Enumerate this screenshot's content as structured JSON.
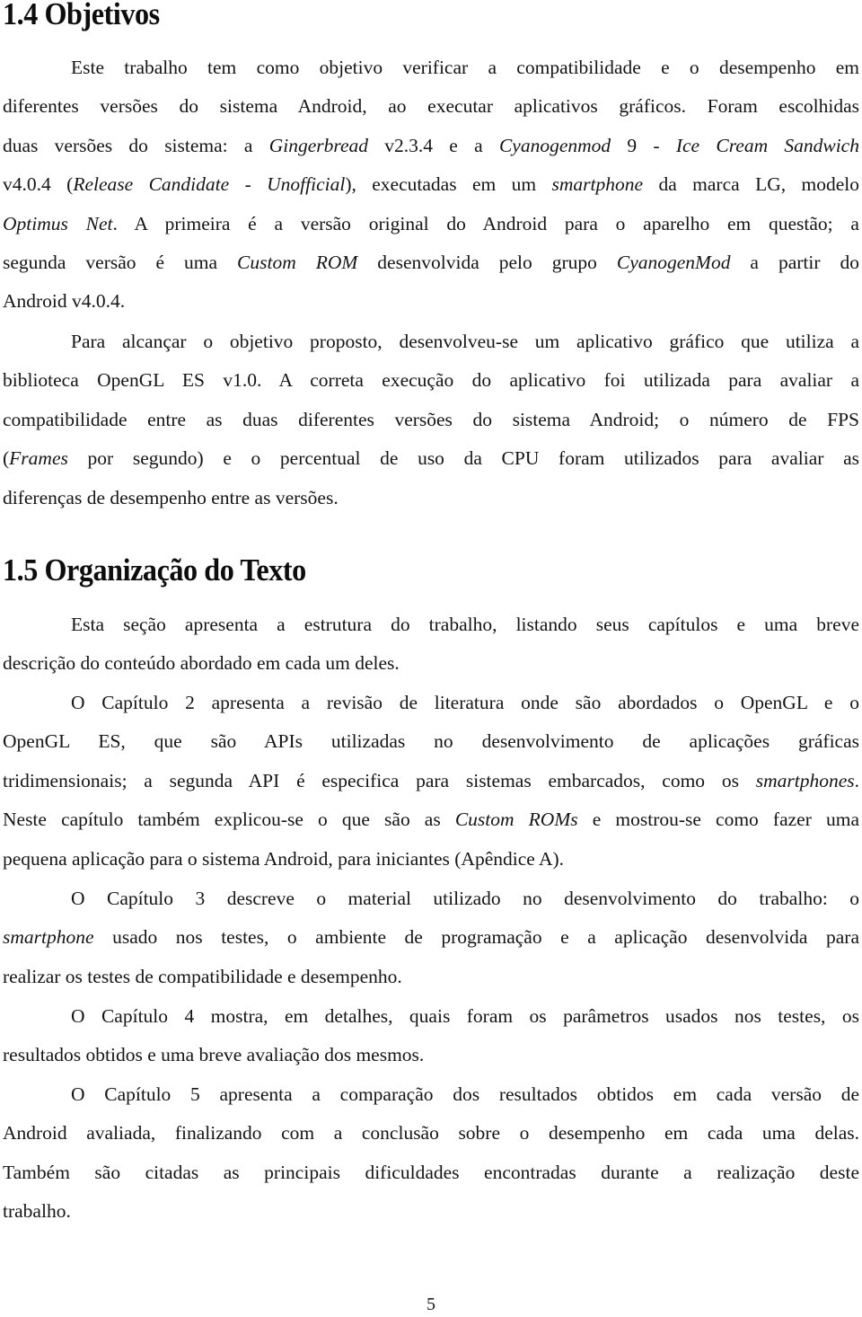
{
  "section_1_4": {
    "title": "1.4 Objetivos",
    "paragraphs": [
      {
        "lines": [
          [
            {
              "t": "Este trabalho tem como objetivo verificar a compatibilidade e o desempenho em"
            }
          ],
          [
            {
              "t": "diferentes versões do sistema Android, ao executar aplicativos gráficos. Foram escolhidas"
            }
          ],
          [
            {
              "t": "duas versões do sistema: a "
            },
            {
              "t": "Gingerbread",
              "i": true
            },
            {
              "t": " v2.3.4 e a "
            },
            {
              "t": "Cyanogenmod",
              "i": true
            },
            {
              "t": " 9 - "
            },
            {
              "t": "Ice Cream Sandwich",
              "i": true
            }
          ],
          [
            {
              "t": "v4.0.4 ("
            },
            {
              "t": "Release Candidate",
              "i": true
            },
            {
              "t": " - "
            },
            {
              "t": "Unofficial",
              "i": true
            },
            {
              "t": "), executadas em um "
            },
            {
              "t": "smartphone",
              "i": true
            },
            {
              "t": " da marca LG, modelo"
            }
          ],
          [
            {
              "t": "Optimus Net",
              "i": true
            },
            {
              "t": ". A primeira é a versão original do Android para o aparelho em questão; a"
            }
          ],
          [
            {
              "t": "segunda versão é uma "
            },
            {
              "t": "Custom ROM",
              "i": true
            },
            {
              "t": " desenvolvida pelo grupo "
            },
            {
              "t": "CyanogenMod",
              "i": true
            },
            {
              "t": " a partir do"
            }
          ],
          [
            {
              "t": "Android v4.0.4."
            }
          ]
        ]
      },
      {
        "lines": [
          [
            {
              "t": "Para alcançar o objetivo proposto, desenvolveu-se um aplicativo gráfico que utiliza a"
            }
          ],
          [
            {
              "t": "biblioteca OpenGL ES v1.0. A correta execução do aplicativo foi utilizada para avaliar a"
            }
          ],
          [
            {
              "t": "compatibilidade entre as duas diferentes versões do sistema Android; o número de FPS"
            }
          ],
          [
            {
              "t": "("
            },
            {
              "t": "Frames",
              "i": true
            },
            {
              "t": " por segundo) e o percentual de uso da CPU foram utilizados para avaliar as"
            }
          ],
          [
            {
              "t": "diferenças de desempenho entre as versões."
            }
          ]
        ]
      }
    ]
  },
  "section_1_5": {
    "title": "1.5 Organização do Texto",
    "paragraphs": [
      {
        "lines": [
          [
            {
              "t": "Esta seção apresenta a estrutura do trabalho, listando seus capítulos e uma breve"
            }
          ],
          [
            {
              "t": "descrição do conteúdo abordado em cada um deles."
            }
          ]
        ]
      },
      {
        "lines": [
          [
            {
              "t": "O Capítulo 2 apresenta a revisão de literatura onde são abordados o OpenGL e o"
            }
          ],
          [
            {
              "t": "OpenGL ES, que são APIs utilizadas no desenvolvimento de aplicações gráficas"
            }
          ],
          [
            {
              "t": "tridimensionais; a segunda API é especifica para sistemas embarcados, como os "
            },
            {
              "t": "smartphones",
              "i": true
            },
            {
              "t": "."
            }
          ],
          [
            {
              "t": "Neste capítulo também explicou-se o que são as "
            },
            {
              "t": "Custom ROMs",
              "i": true
            },
            {
              "t": " e mostrou-se como fazer uma"
            }
          ],
          [
            {
              "t": "pequena aplicação para o sistema Android, para iniciantes (Apêndice A)."
            }
          ]
        ]
      },
      {
        "lines": [
          [
            {
              "t": "O Capítulo 3 descreve o material utilizado no desenvolvimento do trabalho: o"
            }
          ],
          [
            {
              "t": "smartphone",
              "i": true
            },
            {
              "t": " usado nos testes, o ambiente de programação e a aplicação desenvolvida para"
            }
          ],
          [
            {
              "t": "realizar os testes de compatibilidade e desempenho."
            }
          ]
        ]
      },
      {
        "lines": [
          [
            {
              "t": "O Capítulo 4 mostra, em detalhes, quais foram os parâmetros usados nos testes, os"
            }
          ],
          [
            {
              "t": "resultados obtidos e uma breve avaliação dos mesmos."
            }
          ]
        ]
      },
      {
        "lines": [
          [
            {
              "t": "O Capítulo 5 apresenta a comparação dos resultados obtidos em cada versão de"
            }
          ],
          [
            {
              "t": "Android avaliada, finalizando com a conclusão sobre o desempenho em cada uma delas."
            }
          ],
          [
            {
              "t": "Também são citadas as principais dificuldades encontradas durante a realização deste"
            }
          ],
          [
            {
              "t": "trabalho."
            }
          ]
        ]
      }
    ]
  },
  "footer": {
    "page_number": "5"
  }
}
